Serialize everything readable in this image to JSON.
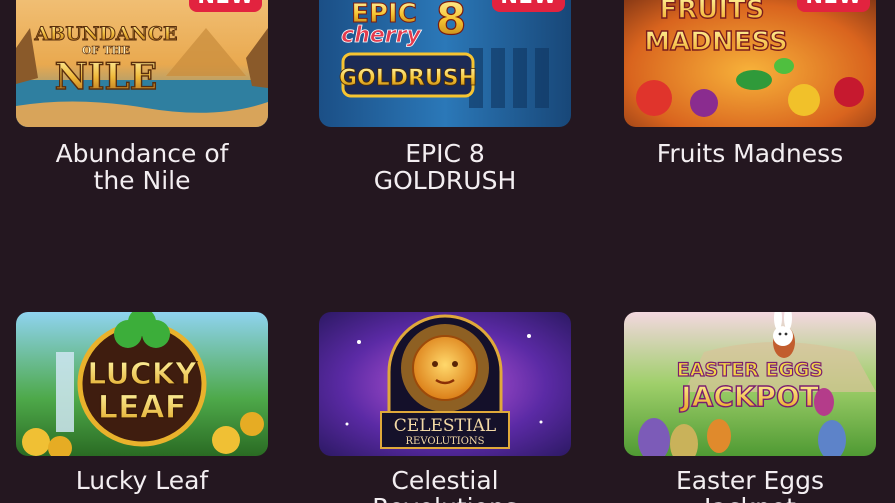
{
  "colors": {
    "background": "#241720",
    "title_text": "#f3eef1",
    "badge_bg": "#e2233f",
    "badge_text": "#ffffff"
  },
  "games": [
    {
      "title_lines": [
        "Abundance of",
        "the Nile"
      ],
      "badge": "NEW",
      "art_text": [
        "ABUNDANCE",
        "OF THE",
        "NILE"
      ]
    },
    {
      "title_lines": [
        "EPIC 8",
        "GOLDRUSH"
      ],
      "badge": "NEW",
      "art_text": [
        "EPIC",
        "8",
        "cherry",
        "GOLDRUSH"
      ]
    },
    {
      "title_lines": [
        "Fruits Madness"
      ],
      "badge": "NEW",
      "art_text": [
        "FRUITS",
        "MADNESS"
      ]
    },
    {
      "title_lines": [
        "Lucky Leaf"
      ],
      "badge": "",
      "art_text": [
        "LUCKY",
        "LEAF"
      ]
    },
    {
      "title_lines": [
        "Celestial",
        "Revolutions"
      ],
      "badge": "",
      "art_text": [
        "CELESTIAL",
        "REVOLUTIONS"
      ]
    },
    {
      "title_lines": [
        "Easter Eggs",
        "Jackpot"
      ],
      "badge": "",
      "art_text": [
        "EASTER EGGS",
        "JACKPOT"
      ]
    }
  ]
}
